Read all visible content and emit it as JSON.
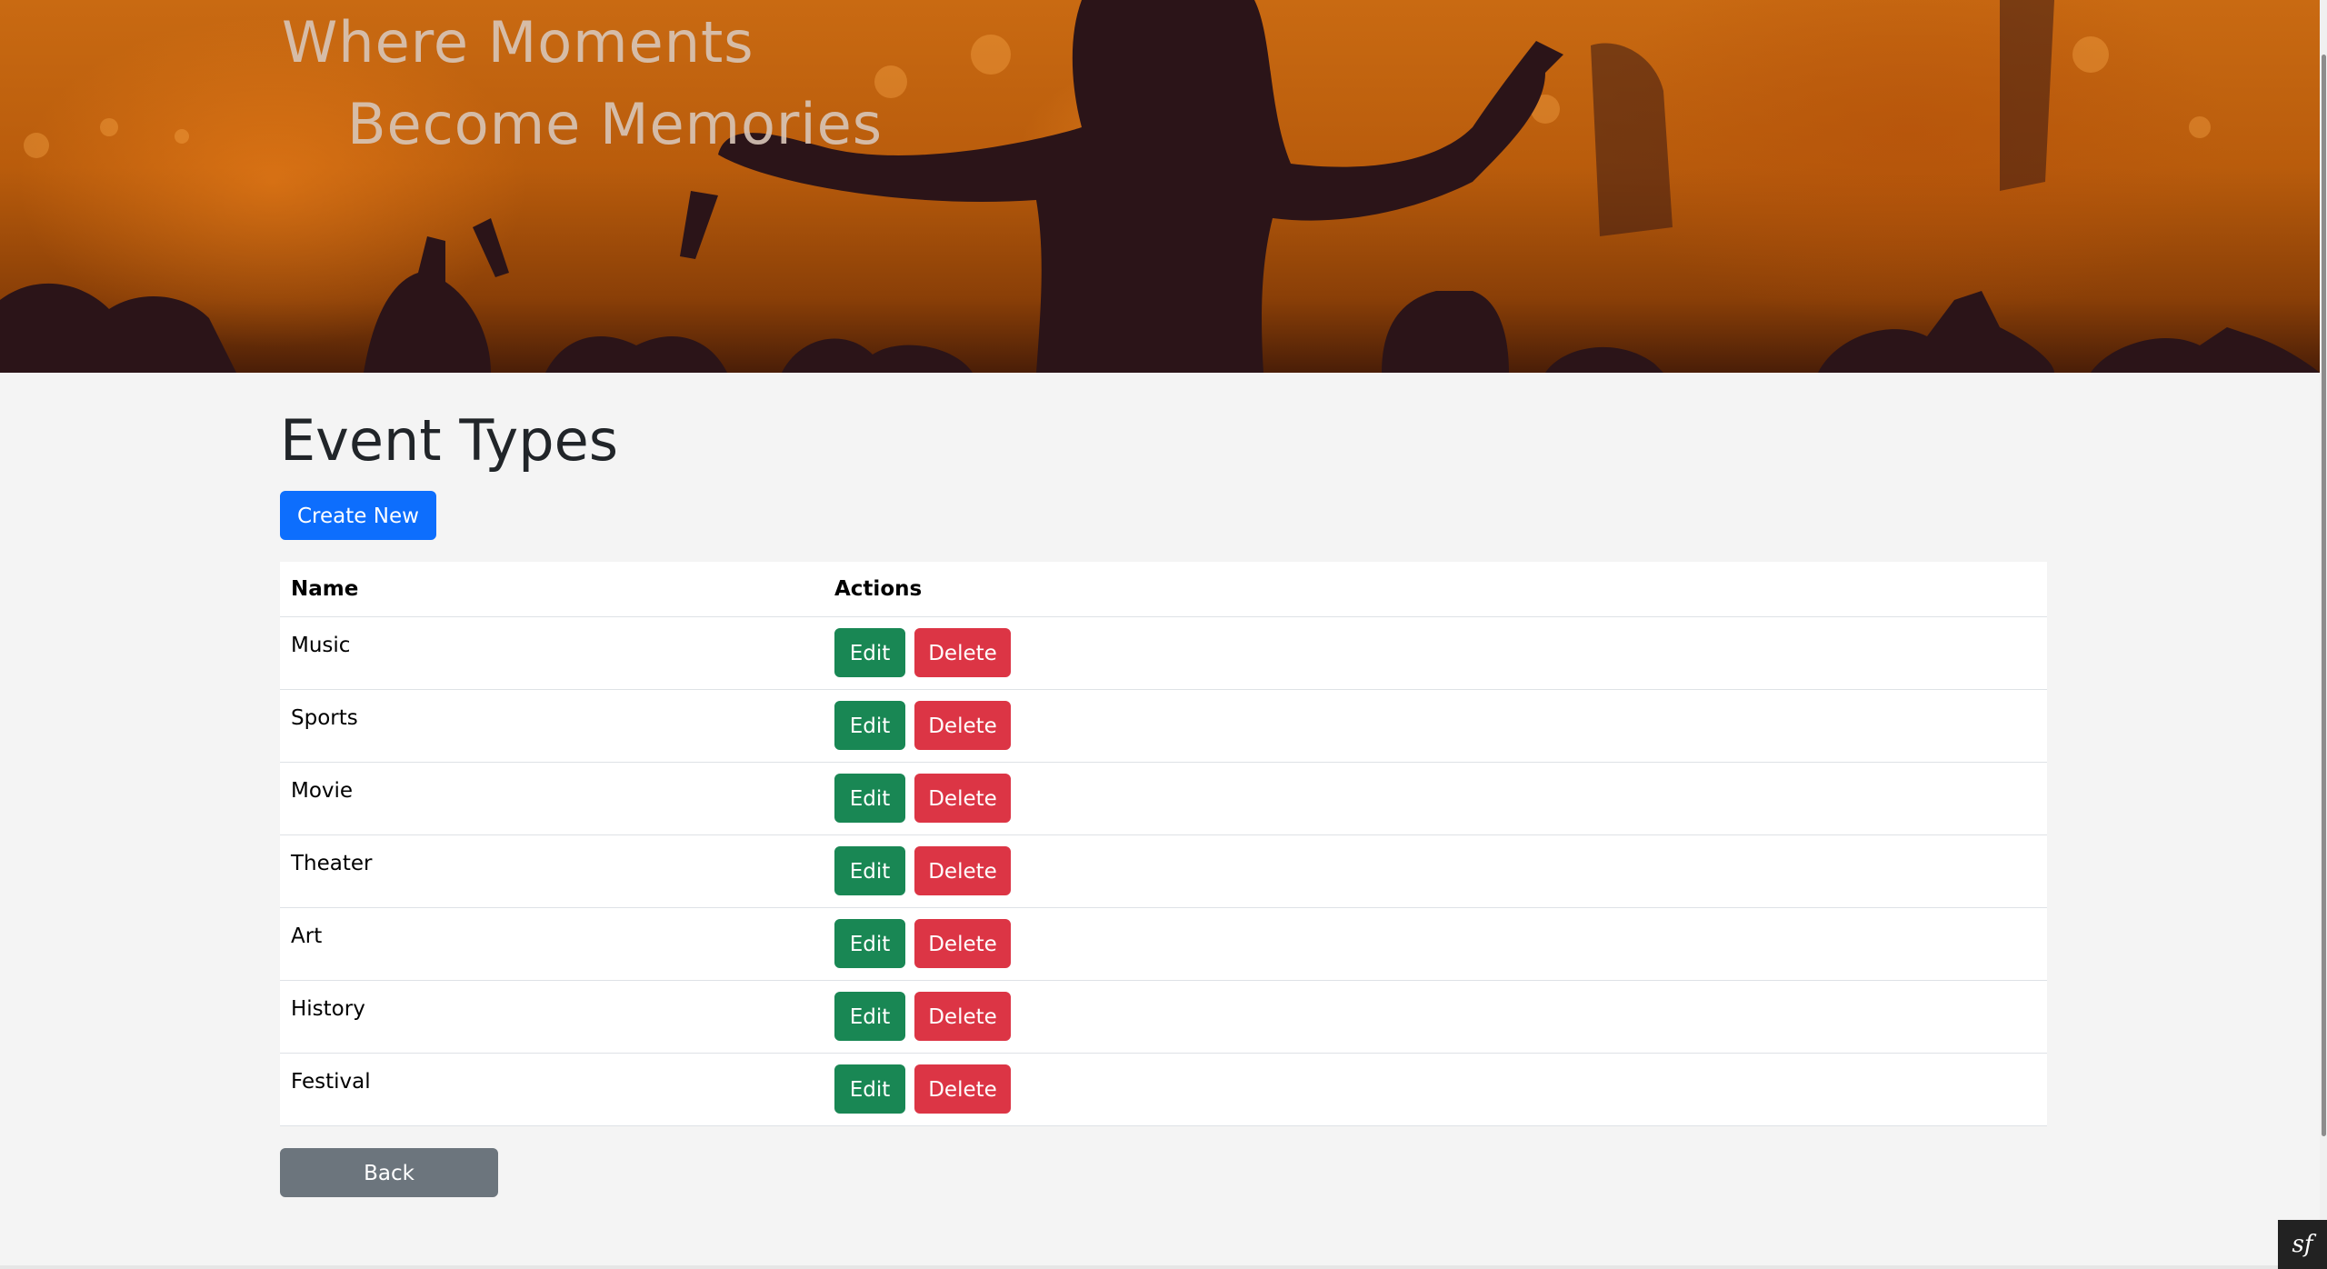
{
  "hero": {
    "title_line1": "Where Moments",
    "title_line2": "Become Memories"
  },
  "page": {
    "title": "Event Types",
    "create_label": "Create New",
    "back_label": "Back"
  },
  "table": {
    "headers": [
      "Name",
      "Actions"
    ],
    "rows": [
      {
        "name": "Music"
      },
      {
        "name": "Sports"
      },
      {
        "name": "Movie"
      },
      {
        "name": "Theater"
      },
      {
        "name": "Art"
      },
      {
        "name": "History"
      },
      {
        "name": "Festival"
      }
    ],
    "edit_label": "Edit",
    "delete_label": "Delete"
  },
  "debug": {
    "icon": "symfony-logo-icon",
    "glyph": "sf"
  },
  "colors": {
    "primary": "#0d6efd",
    "success": "#198754",
    "danger": "#dc3545",
    "secondary": "#6c757d",
    "hero_orange": "#c96a12"
  }
}
